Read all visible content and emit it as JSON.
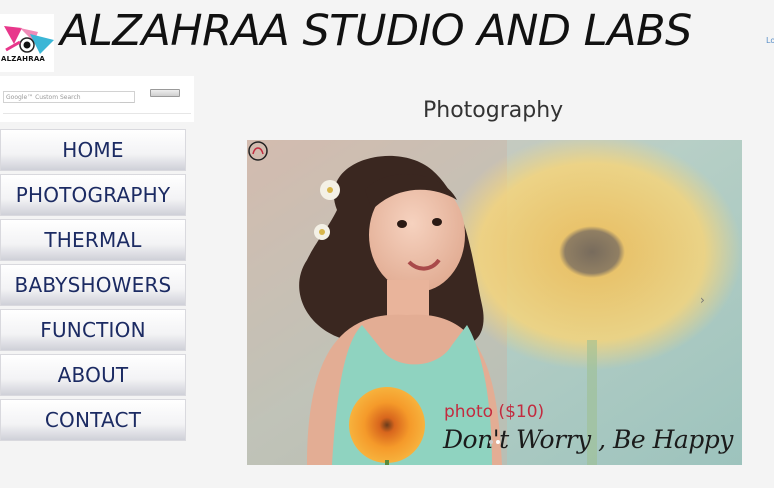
{
  "header": {
    "logo_text": "ALZAHRAA",
    "site_title": "ALZAHRAA STUDIO AND LABS",
    "login_link": "Lo"
  },
  "search": {
    "placeholder": "Google™ Custom Search",
    "button_label": ""
  },
  "nav": {
    "items": [
      {
        "label": "HOME"
      },
      {
        "label": "PHOTOGRAPHY"
      },
      {
        "label": "THERMAL"
      },
      {
        "label": "BABYSHOWERS"
      },
      {
        "label": "FUNCTION"
      },
      {
        "label": "ABOUT"
      },
      {
        "label": "CONTACT"
      }
    ]
  },
  "main": {
    "heading": "Photography",
    "slide": {
      "caption": "photo ($10)",
      "slogan": "Don't Worry , Be Happy",
      "next_icon": "chevron-right-icon",
      "total_slides": 2,
      "active_slide": 1
    }
  },
  "colors": {
    "nav_text": "#1c2b63",
    "caption": "#c32b3f",
    "logo_pink": "#e8378b",
    "logo_cyan": "#3bb6d6"
  }
}
